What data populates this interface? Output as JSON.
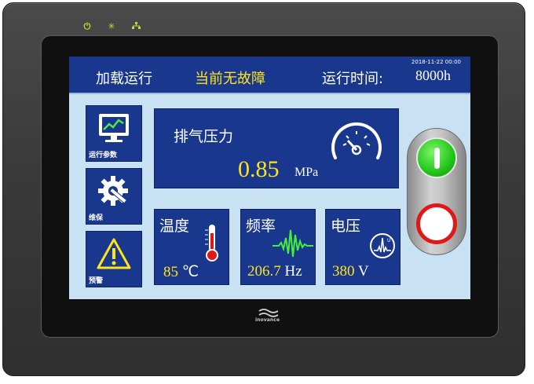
{
  "indicators": [
    {
      "icon": "power-icon",
      "glyph": "⏻"
    },
    {
      "icon": "sun-icon",
      "glyph": "✳"
    },
    {
      "icon": "network-icon",
      "glyph": "品"
    }
  ],
  "header": {
    "datetime": "2018-11-22 00:00",
    "mode": "加载运行",
    "fault_status": "当前无故障",
    "runtime_label": "运行时间:",
    "runtime_value": "8000h"
  },
  "nav": [
    {
      "label": "运行参数",
      "icon": "monitor-chart-icon"
    },
    {
      "label": "维保",
      "icon": "gear-wrench-icon"
    },
    {
      "label": "预警",
      "icon": "warning-icon"
    }
  ],
  "exhaust": {
    "title": "排气压力",
    "value": "0.85",
    "unit": "MPa",
    "icon": "gauge-icon"
  },
  "temperature": {
    "title": "温度",
    "value": "85",
    "unit": "℃",
    "icon": "thermometer-icon"
  },
  "frequency": {
    "title": "频率",
    "value": "206.7",
    "unit": "Hz",
    "icon": "waveform-icon"
  },
  "voltage": {
    "title": "电压",
    "value": "380",
    "unit": "V",
    "icon": "voltage-meter-icon"
  },
  "controls": {
    "start_icon": "start-icon",
    "stop_icon": "stop-icon"
  },
  "brand": {
    "name": "inovance"
  },
  "colors": {
    "panel": "#19378c",
    "screen_bg": "#c8e2f4",
    "value_yellow": "#ffe31a",
    "led_green": "#b8e03a",
    "start_green": "#22c41a",
    "stop_red": "#e01818"
  }
}
